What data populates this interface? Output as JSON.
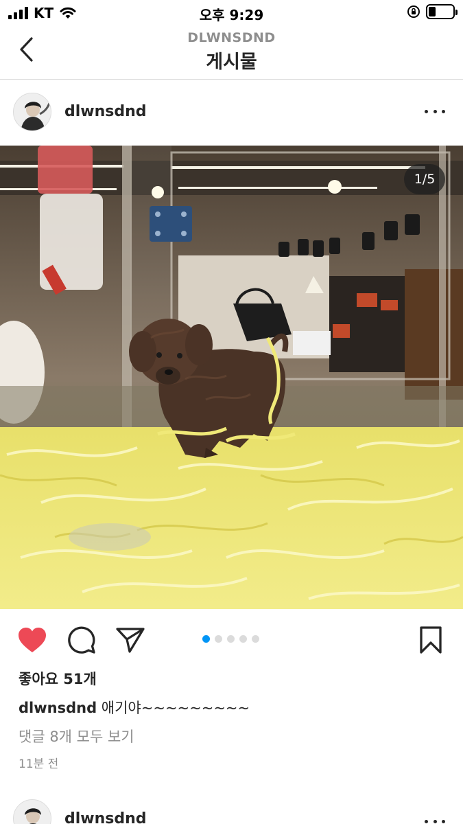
{
  "status_bar": {
    "carrier": "KT",
    "time": "오후 9:29",
    "battery_level": 0.3
  },
  "header": {
    "username_caps": "DLWNSDND",
    "title": "게시물",
    "back_icon": "chevron-left-icon"
  },
  "post": {
    "username": "dlwnsdnd",
    "more_icon": "more-horizontal-icon",
    "photo_description": "brown poodle puppy in pet shop display case on yellow shredded paper",
    "page_indicator": "1/5",
    "carousel": {
      "count": 5,
      "active": 1
    },
    "likes": "좋아요 51개",
    "caption_user": "dlwnsdnd",
    "caption_text": "애기야~~~~~~~~~",
    "view_comments": "댓글 8개 모두 보기",
    "time_ago": "11분 전",
    "liked": true,
    "colors": {
      "heart": "#ed4956",
      "active_dot": "#0095f6"
    }
  },
  "next_post": {
    "username": "dlwnsdnd"
  }
}
